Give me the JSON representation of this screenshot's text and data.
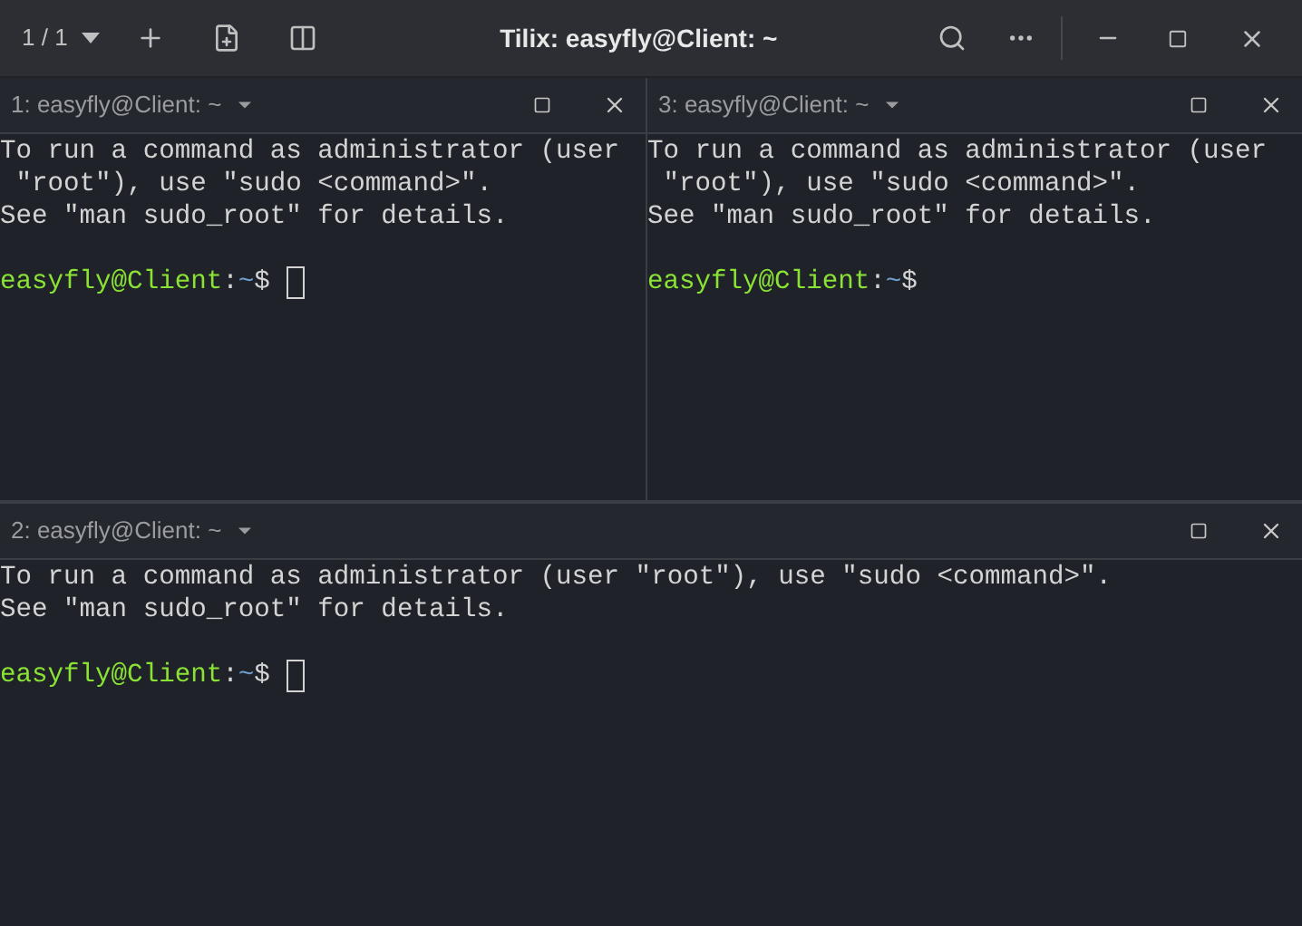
{
  "window": {
    "title": "Tilix: easyfly@Client: ~",
    "session_count": "1 / 1"
  },
  "panes_top": [
    {
      "title": "1: easyfly@Client: ~",
      "lines": [
        "To run a command as administrator (user",
        " \"root\"), use \"sudo <command>\".",
        "See \"man sudo_root\" for details."
      ],
      "prompt": {
        "user": "easyfly@Client",
        "sep": ":",
        "path": "~",
        "sign": "$"
      },
      "cursor": true
    },
    {
      "title": "3: easyfly@Client: ~",
      "lines": [
        "To run a command as administrator (user",
        " \"root\"), use \"sudo <command>\".",
        "See \"man sudo_root\" for details."
      ],
      "prompt": {
        "user": "easyfly@Client",
        "sep": ":",
        "path": "~",
        "sign": "$"
      },
      "cursor": false
    }
  ],
  "pane_bottom": {
    "title": "2: easyfly@Client: ~",
    "lines": [
      "To run a command as administrator (user \"root\"), use \"sudo <command>\".",
      "See \"man sudo_root\" for details."
    ],
    "prompt": {
      "user": "easyfly@Client",
      "sep": ":",
      "path": "~",
      "sign": "$"
    },
    "cursor": true
  }
}
